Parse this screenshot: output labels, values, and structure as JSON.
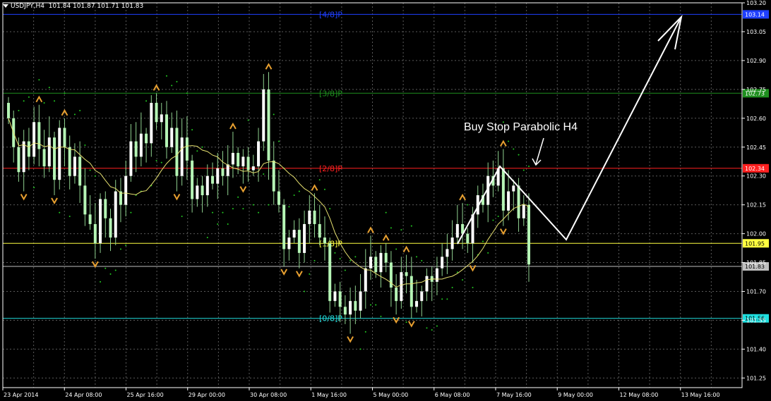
{
  "header": {
    "symbol": "USDJPY,H4",
    "ohlc": "101.84 101.87 101.71 101.83"
  },
  "annotation": "Buy Stop Parabolic H4",
  "colors": {
    "background": "#000000",
    "grid": "#5a5a5a",
    "axis": "#ffffff",
    "bull": "#ffffff",
    "bear": "#b5f5b5",
    "wick": "#8fd18f",
    "ma": "#e6e070",
    "sar": "#22cc22",
    "fractal": "#e8a030",
    "projection": "#ffffff"
  },
  "chart_data": {
    "type": "candlestick",
    "ylim": [
      101.2,
      103.2
    ],
    "y_ticks": [
      "103.20",
      "103.05",
      "102.90",
      "102.75",
      "102.60",
      "102.45",
      "102.30",
      "102.15",
      "102.00",
      "101.85",
      "101.70",
      "101.55",
      "101.40",
      "101.25"
    ],
    "x_ticks": [
      "23 Apr 2014",
      "24 Apr 08:00",
      "25 Apr 16:00",
      "29 Apr 00:00",
      "30 Apr 08:00",
      "1 May 16:00",
      "5 May 00:00",
      "6 May 08:00",
      "7 May 16:00",
      "9 May 00:00",
      "12 May 08:00",
      "13 May 16:00"
    ],
    "levels": [
      {
        "label": "[4/8]P",
        "tag": "103.14",
        "value": 103.14,
        "color": "#1f3fff"
      },
      {
        "label": "[3/8]P",
        "tag": "102.73",
        "value": 102.73,
        "color": "#1f8f1f"
      },
      {
        "label": "[2/8]P",
        "tag": "102.34",
        "value": 102.34,
        "color": "#ff2020"
      },
      {
        "label": "[1/8]P",
        "tag": "101.95",
        "value": 101.95,
        "color": "#ffff40"
      },
      {
        "label": "",
        "tag": "101.83",
        "value": 101.83,
        "color": "#c0c0c0"
      },
      {
        "label": "[0/8]P",
        "tag": "101.56",
        "value": 101.56,
        "color": "#20e0e0"
      }
    ],
    "closes": [
      102.6,
      102.45,
      102.32,
      102.48,
      102.4,
      102.58,
      102.44,
      102.35,
      102.5,
      102.28,
      102.55,
      102.45,
      102.3,
      102.4,
      102.25,
      102.1,
      102.05,
      101.95,
      102.18,
      102.08,
      101.98,
      102.22,
      102.15,
      102.3,
      102.48,
      102.4,
      102.52,
      102.47,
      102.68,
      102.58,
      102.62,
      102.45,
      102.55,
      102.3,
      102.5,
      102.38,
      102.18,
      102.25,
      102.2,
      102.3,
      102.26,
      102.34,
      102.3,
      102.36,
      102.42,
      102.35,
      102.4,
      102.33,
      102.35,
      102.48,
      102.75,
      102.38,
      102.22,
      102.15,
      101.92,
      101.98,
      102.02,
      101.9,
      102.05,
      102.12,
      102.05,
      101.98,
      101.95,
      101.65,
      101.7,
      101.62,
      101.58,
      101.65,
      101.6,
      101.7,
      101.82,
      101.88,
      101.8,
      101.9,
      101.85,
      101.72,
      101.65,
      101.8,
      101.78,
      101.62,
      101.65,
      101.7,
      101.78,
      101.75,
      101.82,
      101.88,
      101.92,
      101.98,
      102.05,
      102.0,
      101.95,
      102.1,
      102.2,
      102.15,
      102.3,
      102.25,
      102.34,
      102.12,
      102.22,
      102.25,
      102.08,
      102.15,
      101.84
    ]
  }
}
